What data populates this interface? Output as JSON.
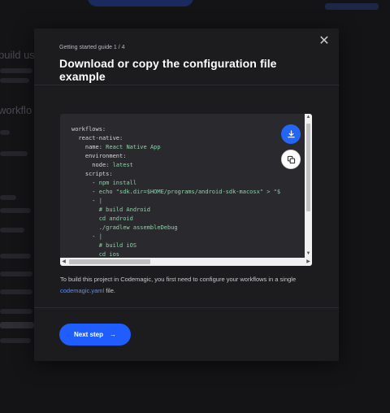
{
  "modal": {
    "guide_step": "Getting started guide 1 / 4",
    "title": "Download or copy the configuration file example",
    "close_glyph": "✕",
    "code_lines": [
      {
        "indent": 0,
        "key": "workflows:",
        "value": ""
      },
      {
        "indent": 2,
        "key": "react-native:",
        "value": ""
      },
      {
        "indent": 4,
        "key": "name: ",
        "value": "React Native App"
      },
      {
        "indent": 4,
        "key": "environment:",
        "value": ""
      },
      {
        "indent": 6,
        "key": "node: ",
        "value": "latest"
      },
      {
        "indent": 4,
        "key": "scripts:",
        "value": ""
      },
      {
        "indent": 6,
        "key": "- ",
        "value": "npm install"
      },
      {
        "indent": 6,
        "key": "- ",
        "value": "echo \"sdk.dir=$HOME/programs/android-sdk-macosx\" > \"$"
      },
      {
        "indent": 6,
        "key": "- ",
        "value": "|"
      },
      {
        "indent": 8,
        "key": "",
        "value": "# build Android"
      },
      {
        "indent": 8,
        "key": "",
        "value": "cd android"
      },
      {
        "indent": 8,
        "key": "",
        "value": "./gradlew assembleDebug"
      },
      {
        "indent": 6,
        "key": "- ",
        "value": "|"
      },
      {
        "indent": 8,
        "key": "",
        "value": "# build iOS"
      },
      {
        "indent": 8,
        "key": "",
        "value": "cd ios"
      }
    ],
    "description_prefix": "To build this project in Codemagic, you first need to configure your workflows in a single ",
    "description_link": "codemagic.yaml",
    "description_suffix": " file.",
    "next_label": "Next step",
    "next_arrow": "→",
    "colors": {
      "accent": "#1f5dff",
      "link": "#5b8dff",
      "code_value": "#8fd0a8"
    },
    "icons": [
      "close-icon",
      "download-icon",
      "copy-icon",
      "arrow-right-icon"
    ]
  },
  "background": {
    "lines": [
      "build usin",
      "workflo"
    ]
  }
}
